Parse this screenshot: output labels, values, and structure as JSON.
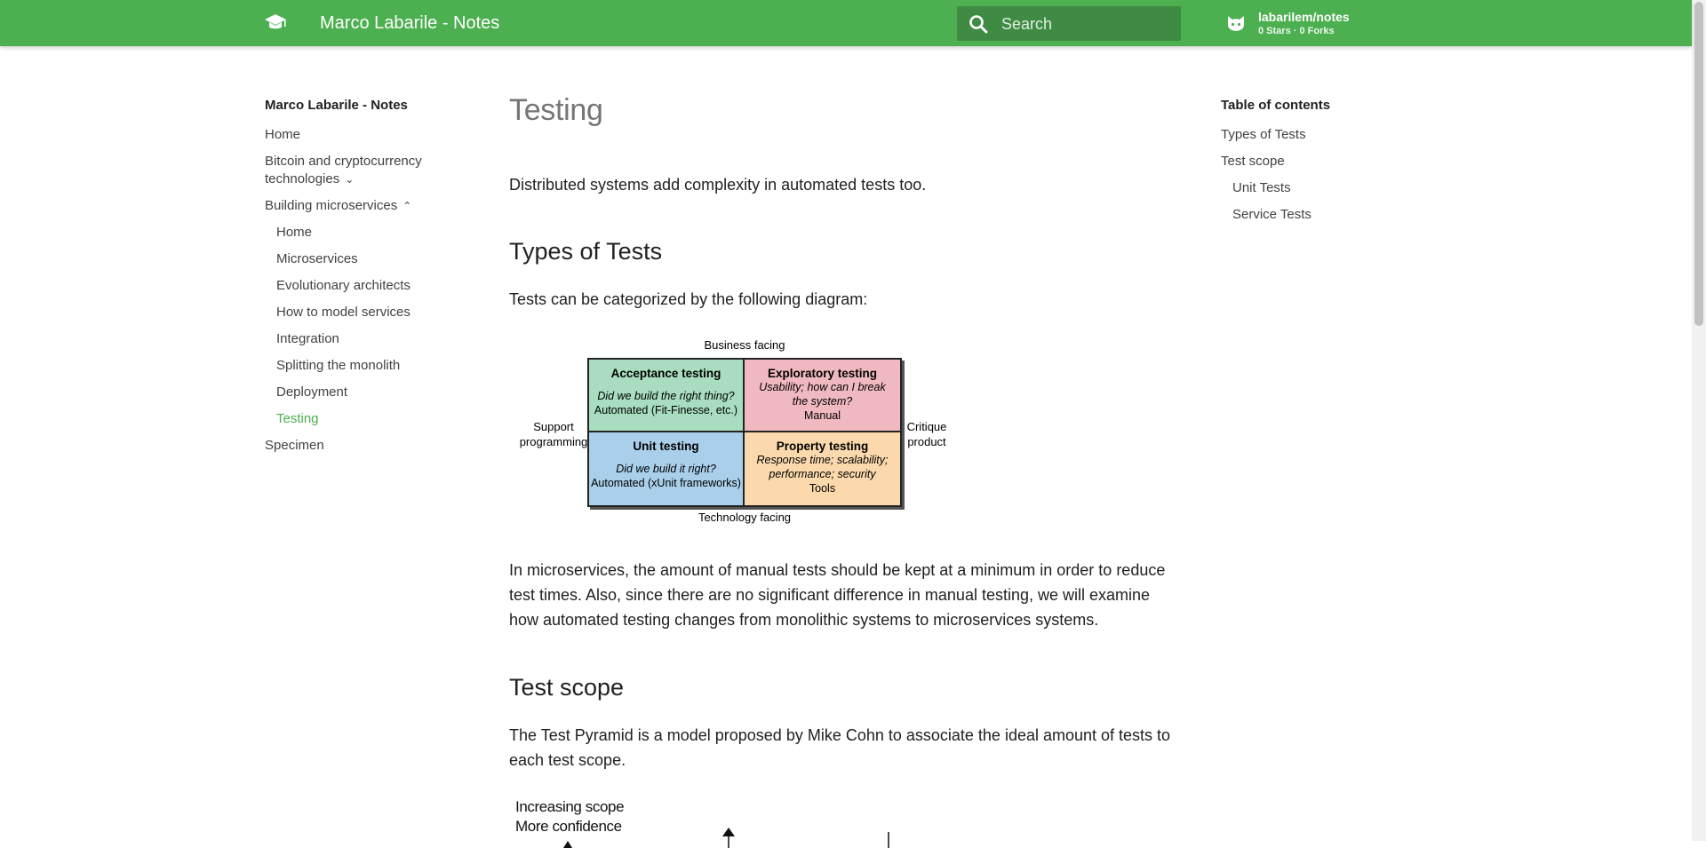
{
  "header": {
    "site_title": "Marco Labarile - Notes",
    "search_placeholder": "Search",
    "repo_name": "labarilem/notes",
    "repo_stats": "0 Stars · 0 Forks"
  },
  "nav": {
    "title": "Marco Labarile - Notes",
    "items": [
      {
        "label": "Home"
      },
      {
        "label": "Bitcoin and cryptocurrency technologies"
      },
      {
        "label": "Building microservices"
      },
      {
        "label": "Specimen"
      }
    ],
    "sub_items": [
      {
        "label": "Home"
      },
      {
        "label": "Microservices"
      },
      {
        "label": "Evolutionary architects"
      },
      {
        "label": "How to model services"
      },
      {
        "label": "Integration"
      },
      {
        "label": "Splitting the monolith"
      },
      {
        "label": "Deployment"
      },
      {
        "label": "Testing"
      }
    ]
  },
  "toc": {
    "title": "Table of contents",
    "items": [
      {
        "label": "Types of Tests"
      },
      {
        "label": "Test scope"
      },
      {
        "label": "Unit Tests"
      },
      {
        "label": "Service Tests"
      }
    ]
  },
  "content": {
    "h1": "Testing",
    "intro": "Distributed systems add complexity in automated tests too.",
    "h2_types": "Types of Tests",
    "types_text": "Tests can be categorized by the following diagram:",
    "paragraph2": "In microservices, the amount of manual tests should be kept at a minimum in order to reduce test times. Also, since there are no significant difference in manual testing, we will examine how automated testing changes from monolithic systems to microservices systems.",
    "h2_scope": "Test scope",
    "scope_text": "The Test Pyramid is a model proposed by Mike Cohn to associate the ideal amount of tests to each test scope."
  },
  "diagram": {
    "top": "Business facing",
    "bottom": "Technology facing",
    "left": "Support programming",
    "right": "Critique product",
    "quadrants": [
      {
        "title": "Acceptance testing",
        "sub": "Did we build the right thing?",
        "method": "Automated (Fit-Finesse, etc.)",
        "color": "#a8ddc0"
      },
      {
        "title": "Exploratory testing",
        "sub": "Usability; how can I break the system?",
        "method": "Manual",
        "color": "#f0b9c0"
      },
      {
        "title": "Unit testing",
        "sub": "Did we build it right?",
        "method": "Automated (xUnit frameworks)",
        "color": "#a9cfeb"
      },
      {
        "title": "Property testing",
        "sub": "Response time; scalability; performance; security",
        "method": "Tools",
        "color": "#fbd9ac"
      }
    ]
  },
  "pyramid": {
    "line1": "Increasing scope",
    "line2": "More confidence"
  },
  "colors": {
    "primary": "#4caf50",
    "active_nav": "#4caf50"
  }
}
